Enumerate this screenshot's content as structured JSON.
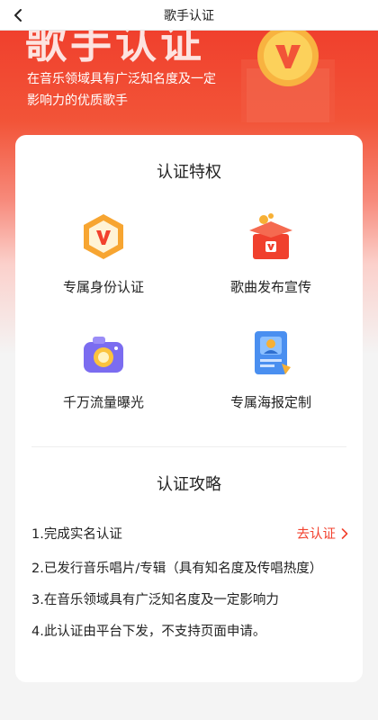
{
  "header": {
    "title": "歌手认证",
    "back_icon": "chevron-left-icon"
  },
  "hero": {
    "title": "歌手认证",
    "description": "在音乐领域具有广泛知名度及一定影响力的优质歌手",
    "badge_icon": "v-badge-icon"
  },
  "privileges": {
    "title": "认证特权",
    "items": [
      {
        "label": "专属身份认证",
        "icon": "identity-badge-icon"
      },
      {
        "label": "歌曲发布宣传",
        "icon": "gift-box-icon"
      },
      {
        "label": "千万流量曝光",
        "icon": "camera-icon"
      },
      {
        "label": "专属海报定制",
        "icon": "poster-icon"
      }
    ]
  },
  "guide": {
    "title": "认证攻略",
    "steps": [
      "1.完成实名认证",
      "2.已发行音乐唱片/专辑（具有知名度及传唱热度）",
      "3.在音乐领域具有广泛知名度及一定影响力",
      "4.此认证由平台下发，不支持页面申请。"
    ],
    "action_label": "去认证"
  },
  "colors": {
    "accent": "#f2412d",
    "hero_top": "#f0402d",
    "background": "#f4f4f4"
  }
}
